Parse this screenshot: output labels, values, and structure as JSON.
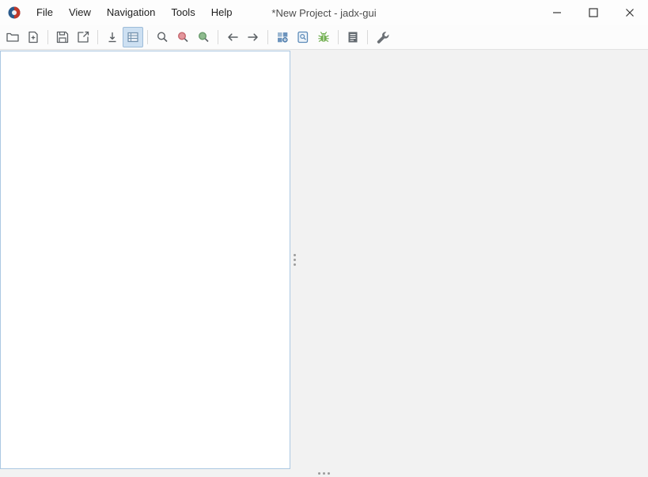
{
  "window": {
    "title": "*New Project - jadx-gui"
  },
  "menu": {
    "items": [
      {
        "label": "File"
      },
      {
        "label": "View"
      },
      {
        "label": "Navigation"
      },
      {
        "label": "Tools"
      },
      {
        "label": "Help"
      }
    ]
  },
  "toolbar": {
    "buttons": [
      {
        "name": "open-file",
        "icon": "folder-open-icon",
        "active": false
      },
      {
        "name": "add-files",
        "icon": "add-files-icon",
        "active": false
      },
      {
        "name": "save-project",
        "icon": "save-icon",
        "active": false
      },
      {
        "name": "export",
        "icon": "export-icon",
        "active": false
      },
      {
        "name": "sync-with-editor",
        "icon": "sync-icon",
        "active": false
      },
      {
        "name": "flat-packages",
        "icon": "flat-packages-icon",
        "active": true
      },
      {
        "name": "text-search",
        "icon": "search-icon",
        "active": false
      },
      {
        "name": "class-search",
        "icon": "search-red-icon",
        "active": false
      },
      {
        "name": "comment-search",
        "icon": "search-green-icon",
        "active": false
      },
      {
        "name": "back",
        "icon": "arrow-left-icon",
        "active": false
      },
      {
        "name": "forward",
        "icon": "arrow-right-icon",
        "active": false
      },
      {
        "name": "deobfuscation",
        "icon": "deobfuscation-icon",
        "active": false
      },
      {
        "name": "quark-report",
        "icon": "quark-icon",
        "active": false
      },
      {
        "name": "debugger",
        "icon": "android-debug-icon",
        "active": false
      },
      {
        "name": "log-viewer",
        "icon": "log-viewer-icon",
        "active": false
      },
      {
        "name": "preferences",
        "icon": "wrench-icon",
        "active": false
      }
    ]
  },
  "window_controls": {
    "minimize": "minimize-icon",
    "maximize": "maximize-icon",
    "close": "close-icon"
  },
  "colors": {
    "titlebar_bg": "#fdfdfd",
    "toolbar_bg": "#fcfcfc",
    "content_bg": "#f2f2f2",
    "panel_bg": "#ffffff",
    "panel_border": "#abc8e2",
    "active_button_bg": "#cde0f2",
    "active_button_border": "#9dbcd9"
  }
}
